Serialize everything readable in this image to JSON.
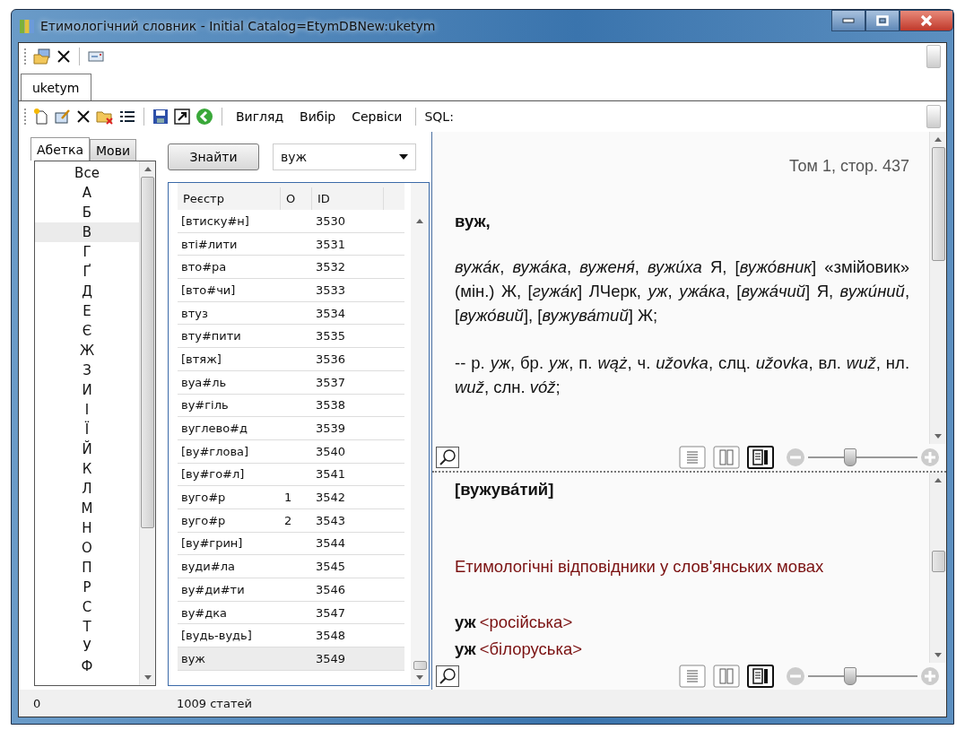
{
  "window": {
    "title": "Етимологічний словник - Initial Catalog=EtymDBNew:uketym"
  },
  "document_tabs": [
    {
      "label": "uketym",
      "selected": true
    }
  ],
  "toolbar": {
    "menus": [
      "Вигляд",
      "Вибір",
      "Сервіси"
    ],
    "sql_label": "SQL:"
  },
  "left_tabs": [
    {
      "label": "Абетка",
      "selected": true
    },
    {
      "label": "Мови",
      "selected": false
    }
  ],
  "letters": [
    {
      "label": "Все",
      "selected": false
    },
    {
      "label": "А",
      "selected": false
    },
    {
      "label": "Б",
      "selected": false
    },
    {
      "label": "В",
      "selected": true
    },
    {
      "label": "Г",
      "selected": false
    },
    {
      "label": "Ґ",
      "selected": false
    },
    {
      "label": "Д",
      "selected": false
    },
    {
      "label": "Е",
      "selected": false
    },
    {
      "label": "Є",
      "selected": false
    },
    {
      "label": "Ж",
      "selected": false
    },
    {
      "label": "З",
      "selected": false
    },
    {
      "label": "И",
      "selected": false
    },
    {
      "label": "І",
      "selected": false
    },
    {
      "label": "Ї",
      "selected": false
    },
    {
      "label": "Й",
      "selected": false
    },
    {
      "label": "К",
      "selected": false
    },
    {
      "label": "Л",
      "selected": false
    },
    {
      "label": "М",
      "selected": false
    },
    {
      "label": "Н",
      "selected": false
    },
    {
      "label": "О",
      "selected": false
    },
    {
      "label": "П",
      "selected": false
    },
    {
      "label": "Р",
      "selected": false
    },
    {
      "label": "С",
      "selected": false
    },
    {
      "label": "Т",
      "selected": false
    },
    {
      "label": "У",
      "selected": false
    },
    {
      "label": "Ф",
      "selected": false
    }
  ],
  "search": {
    "button": "Знайти",
    "value": "вуж"
  },
  "table": {
    "columns": [
      "Реєстр",
      "О",
      "ID"
    ],
    "rows": [
      {
        "entry": "[втиску#н]",
        "id": "3530",
        "selected": false
      },
      {
        "entry": "вті#лити",
        "id": "3531",
        "selected": false
      },
      {
        "entry": "вто#ра",
        "id": "3532",
        "selected": false
      },
      {
        "entry": "[вто#чи]",
        "id": "3533",
        "selected": false
      },
      {
        "entry": "втуз",
        "id": "3534",
        "selected": false
      },
      {
        "entry": "вту#пити",
        "id": "3535",
        "selected": false
      },
      {
        "entry": "[втяж]",
        "id": "3536",
        "selected": false
      },
      {
        "entry": "вуа#ль",
        "id": "3537",
        "selected": false
      },
      {
        "entry": "ву#гіль",
        "id": "3538",
        "selected": false
      },
      {
        "entry": "вуглево#д",
        "id": "3539",
        "selected": false
      },
      {
        "entry": "[ву#глова]",
        "id": "3540",
        "selected": false
      },
      {
        "entry": "[ву#го#л]",
        "id": "3541",
        "selected": false
      },
      {
        "entry": "вуго#р",
        "homonym": "1",
        "id": "3542",
        "selected": false
      },
      {
        "entry": "вуго#р",
        "homonym": "2",
        "id": "3543",
        "selected": false
      },
      {
        "entry": "[ву#грин]",
        "id": "3544",
        "selected": false
      },
      {
        "entry": "вуди#ла",
        "id": "3545",
        "selected": false
      },
      {
        "entry": "ву#ди#ти",
        "id": "3546",
        "selected": false
      },
      {
        "entry": "ву#дка",
        "id": "3547",
        "selected": false
      },
      {
        "entry": "[вудь-вудь]",
        "id": "3548",
        "selected": false
      },
      {
        "entry": "вуж",
        "id": "3549",
        "selected": true
      }
    ]
  },
  "article": {
    "page_ref": "Том 1, стор. 437",
    "headword": "вуж,",
    "paragraphs": [
      "*вужа́к*, *вужа́ка*, *вуженя́*, *вужи́ха* Я, [*вужо́вник*] «змійовик» (мін.) Ж, [*гужа́к*] ЛЧерк, *уж*, *ужа́ка*, [*вужа́чий*] Я, *вужи́ний*, [*вужо́вий*], [*вужува́тий*] Ж;",
      "-- р. *уж*, бр. *уж*, п. *wąż*, ч. *užovka*, слц. *užovka*, вл. *wuž*, нл. *wuž*, слн. *vóž*;"
    ],
    "view_modes": [
      {
        "kind": "single",
        "selected": false
      },
      {
        "kind": "columns",
        "selected": false
      },
      {
        "kind": "split",
        "selected": true
      }
    ],
    "zoom": {
      "level": 0.38
    }
  },
  "etymology_pane": {
    "headword": "[вужува́тий]",
    "heading": "Етимологічні відповідники у слов'янських мовах",
    "entries": [
      {
        "word": "уж",
        "language": "<російська>"
      },
      {
        "word": "уж",
        "language": "<білоруська>"
      }
    ],
    "view_modes": [
      {
        "kind": "single",
        "selected": false
      },
      {
        "kind": "columns",
        "selected": false
      },
      {
        "kind": "split",
        "selected": true
      }
    ],
    "zoom": {
      "level": 0.38
    }
  },
  "status_bar": [
    "0",
    "1009 статей"
  ]
}
